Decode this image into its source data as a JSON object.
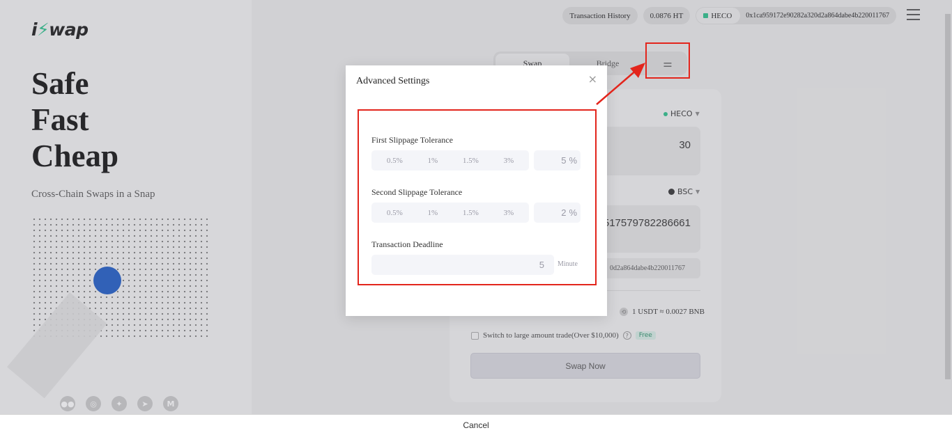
{
  "brand": {
    "logo_prefix": "i",
    "logo_bolt": "⚡",
    "logo_suffix": "wap"
  },
  "hero": {
    "line1": "Safe",
    "line2": "Fast",
    "line3": "Cheap",
    "tagline": "Cross-Chain Swaps in a Snap"
  },
  "social": [
    {
      "icon": "medium-icon",
      "glyph": "●●"
    },
    {
      "icon": "github-icon",
      "glyph": "◎"
    },
    {
      "icon": "twitter-icon",
      "glyph": "✦"
    },
    {
      "icon": "telegram-icon",
      "glyph": "➤"
    },
    {
      "icon": "m-icon",
      "glyph": "M"
    }
  ],
  "topbar": {
    "history_label": "Transaction History",
    "balance": "0.0876 HT",
    "network": "HECO",
    "address": "0x1ca959172e90282a320d2a864dabe4b220011767"
  },
  "tabs": {
    "swap": "Swap",
    "bridge": "Bridge",
    "settings_glyph": "⚌"
  },
  "card": {
    "from_network": "HECO",
    "from_amount": "30",
    "to_network": "BSC",
    "to_amount": "517579782286661",
    "to_address": "0d2a864dabe4b220011767",
    "rate": "1 USDT ≈ 0.0027 BNB",
    "large_trade_label": "Switch to large amount trade(Over $10,000)",
    "free_badge": "Free",
    "swap_button": "Swap Now"
  },
  "modal": {
    "title": "Advanced Settings",
    "close_glyph": "×",
    "first_label": "First Slippage Tolerance",
    "first_options": [
      "0.5%",
      "1%",
      "1.5%",
      "3%"
    ],
    "first_custom": "5",
    "second_label": "Second Slippage Tolerance",
    "second_options": [
      "0.5%",
      "1%",
      "1.5%",
      "3%"
    ],
    "second_custom": "2",
    "percent_unit": "%",
    "deadline_label": "Transaction Deadline",
    "deadline_value": "5",
    "deadline_unit": "Minute"
  },
  "footer": {
    "cancel": "Cancel"
  },
  "colors": {
    "accent_green": "#2bbf8a",
    "annotation_red": "#e3251c",
    "orb_blue": "#1e5bc6"
  }
}
